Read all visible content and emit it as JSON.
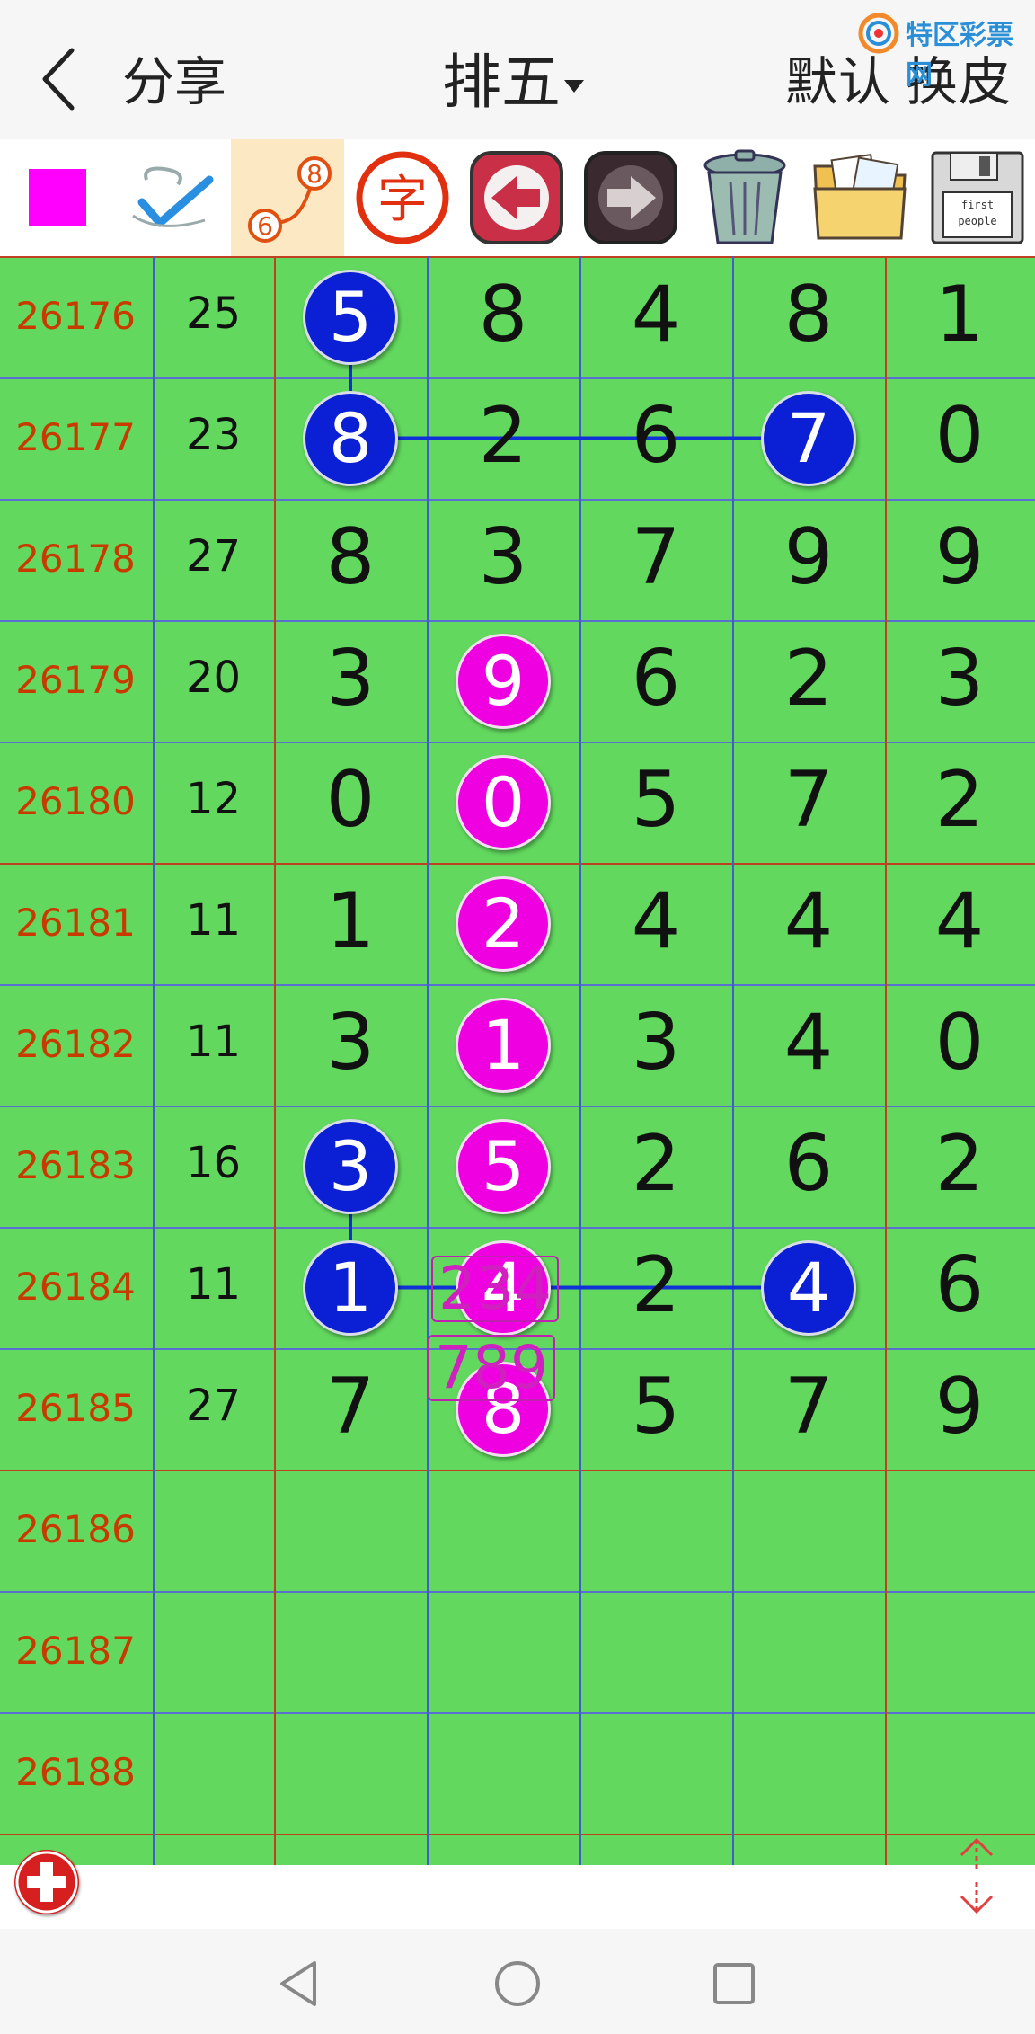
{
  "header": {
    "back_icon": "chevron-left-icon",
    "share_label": "分享",
    "title": "排五",
    "default_label": "默认",
    "skin_label": "换皮",
    "watermark_text": "特区彩票网"
  },
  "toolbar": {
    "items": [
      {
        "name": "color-swatch-tool",
        "icon": "magenta-square-icon",
        "color": "#ff00ff"
      },
      {
        "name": "pen-tool",
        "icon": "pen-check-icon"
      },
      {
        "name": "connect-tool",
        "icon": "connect-numbers-icon",
        "labels": [
          "8",
          "6"
        ]
      },
      {
        "name": "text-tool",
        "icon": "text-char-icon",
        "label": "字"
      },
      {
        "name": "undo-tool",
        "icon": "arrow-left-icon"
      },
      {
        "name": "redo-tool",
        "icon": "arrow-right-icon"
      },
      {
        "name": "trash-tool",
        "icon": "trash-can-icon"
      },
      {
        "name": "gallery-tool",
        "icon": "photo-folder-icon"
      },
      {
        "name": "save-tool",
        "icon": "floppy-disk-icon",
        "labels": [
          "first",
          "people"
        ]
      }
    ]
  },
  "table": {
    "rows": [
      {
        "period": "26176",
        "sum": "25",
        "digits": [
          "5",
          "8",
          "4",
          "8",
          "1"
        ]
      },
      {
        "period": "26177",
        "sum": "23",
        "digits": [
          "8",
          "2",
          "6",
          "7",
          "0"
        ]
      },
      {
        "period": "26178",
        "sum": "27",
        "digits": [
          "8",
          "3",
          "7",
          "9",
          "9"
        ]
      },
      {
        "period": "26179",
        "sum": "20",
        "digits": [
          "3",
          "9",
          "6",
          "2",
          "3"
        ]
      },
      {
        "period": "26180",
        "sum": "12",
        "digits": [
          "0",
          "0",
          "5",
          "7",
          "2"
        ]
      },
      {
        "period": "26181",
        "sum": "11",
        "digits": [
          "1",
          "2",
          "4",
          "4",
          "4"
        ]
      },
      {
        "period": "26182",
        "sum": "11",
        "digits": [
          "3",
          "1",
          "3",
          "4",
          "0"
        ]
      },
      {
        "period": "26183",
        "sum": "16",
        "digits": [
          "3",
          "5",
          "2",
          "6",
          "2"
        ]
      },
      {
        "period": "26184",
        "sum": "11",
        "digits": [
          "1",
          "4",
          "2",
          "4",
          "6"
        ]
      },
      {
        "period": "26185",
        "sum": "27",
        "digits": [
          "7",
          "8",
          "5",
          "7",
          "9"
        ]
      },
      {
        "period": "26186",
        "sum": "",
        "digits": [
          "",
          "",
          "",
          "",
          ""
        ]
      },
      {
        "period": "26187",
        "sum": "",
        "digits": [
          "",
          "",
          "",
          "",
          ""
        ]
      },
      {
        "period": "26188",
        "sum": "",
        "digits": [
          "",
          "",
          "",
          "",
          ""
        ]
      }
    ],
    "highlights": {
      "blue": [
        [
          0,
          0
        ],
        [
          1,
          0
        ],
        [
          1,
          3
        ],
        [
          7,
          0
        ],
        [
          8,
          0
        ],
        [
          8,
          3
        ]
      ],
      "pink": [
        [
          3,
          1
        ],
        [
          4,
          1
        ],
        [
          5,
          1
        ],
        [
          6,
          1
        ],
        [
          7,
          1
        ],
        [
          8,
          1
        ],
        [
          9,
          1
        ]
      ]
    },
    "predictions": [
      "234",
      "789"
    ],
    "colors": {
      "grid_bg": "#62d85e",
      "blue_ball": "#0b1fd4",
      "pink_ball": "#ee00e0",
      "period_text": "#c83a00"
    }
  },
  "bottom": {
    "add_icon": "plus-circle-icon",
    "scroll_icon": "scroll-arrows-icon"
  },
  "navbar": {
    "back_icon": "nav-back-icon",
    "home_icon": "nav-home-icon",
    "recent_icon": "nav-recent-icon"
  }
}
